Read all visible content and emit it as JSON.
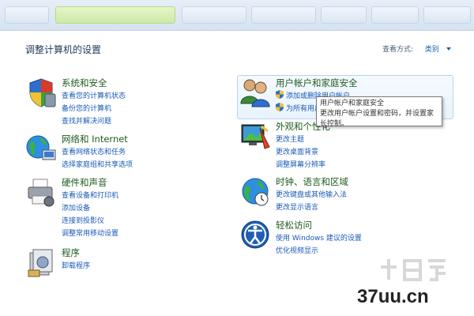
{
  "page": {
    "heading": "调整计算机的设置",
    "view_label": "查看方式:",
    "view_value": "类别"
  },
  "categories": {
    "security": {
      "title": "系统和安全",
      "links": [
        "查看您的计算机状态",
        "备份您的计算机",
        "查找并解决问题"
      ]
    },
    "network": {
      "title": "网络和 Internet",
      "links": [
        "查看网络状态和任务",
        "选择家庭组和共享选项"
      ]
    },
    "hardware": {
      "title": "硬件和声音",
      "links": [
        "查看设备和打印机",
        "添加设备",
        "连接到投影仪",
        "调整常用移动设置"
      ]
    },
    "programs": {
      "title": "程序",
      "links": [
        "卸载程序"
      ]
    },
    "users": {
      "title": "用户帐户和家庭安全",
      "links": [
        "添加或删除用户帐户",
        "为所有用户设置家长控制"
      ]
    },
    "appearance": {
      "title": "外观和个性化",
      "links": [
        "更改主题",
        "更改桌面背景",
        "调整屏幕分辨率"
      ]
    },
    "clock": {
      "title": "时钟、语言和区域",
      "links": [
        "更改键盘或其他输入法",
        "更改显示语言"
      ]
    },
    "ease": {
      "title": "轻松访问",
      "links": [
        "使用 Windows 建议的设置",
        "优化视频显示"
      ]
    }
  },
  "tooltip": {
    "line1": "用户帐户和家庭安全",
    "line2": "更改用户帐户设置和密码，并设置家长控制。"
  },
  "watermark": {
    "site": "37uu.cn"
  },
  "colors": {
    "link": "#1a5bb8",
    "category_title": "#1e5b1e",
    "heading": "#1e395b"
  }
}
